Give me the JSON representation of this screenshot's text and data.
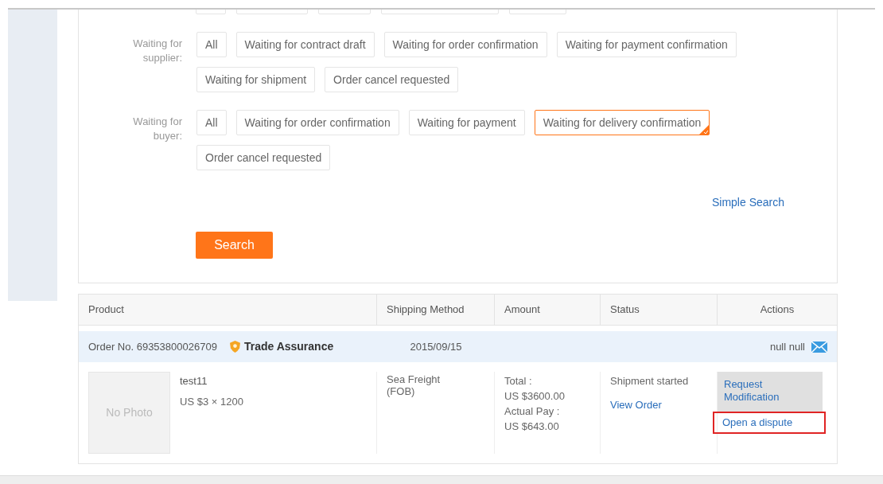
{
  "filter_groups": [
    {
      "label": "Waiting for supplier:",
      "chips": [
        {
          "label": "All",
          "selected": false
        },
        {
          "label": "Waiting for contract draft",
          "selected": false
        },
        {
          "label": "Waiting for order confirmation",
          "selected": false
        },
        {
          "label": "Waiting for payment confirmation",
          "selected": false
        },
        {
          "label": "Waiting for shipment",
          "selected": false
        },
        {
          "label": "Order cancel requested",
          "selected": false
        }
      ]
    },
    {
      "label": "Waiting for buyer:",
      "chips": [
        {
          "label": "All",
          "selected": false
        },
        {
          "label": "Waiting for order confirmation",
          "selected": false
        },
        {
          "label": "Waiting for payment",
          "selected": false
        },
        {
          "label": "Waiting for delivery confirmation",
          "selected": true
        },
        {
          "label": "Order cancel requested",
          "selected": false
        }
      ]
    }
  ],
  "simple_search_link": "Simple Search",
  "search_button": "Search",
  "table": {
    "columns": [
      "Product",
      "Shipping Method",
      "Amount",
      "Status",
      "Actions"
    ],
    "orders": [
      {
        "order_no": "Order No. 69353800026709",
        "badge": "Trade Assurance",
        "date": "2015/09/15",
        "contact": "null null",
        "product": {
          "photo": "No Photo",
          "name": "test11",
          "price": "US $3 × 1200"
        },
        "shipping": "Sea Freight (FOB)",
        "amount": [
          "Total :",
          "US $3600.00",
          "Actual Pay :",
          "US $643.00"
        ],
        "status": "Shipment started",
        "status_link": "View Order",
        "actions": [
          {
            "label": "Request Modification",
            "highlighted": false,
            "hovered": true
          },
          {
            "label": "Open a dispute",
            "highlighted": true,
            "hovered": false
          }
        ]
      }
    ]
  }
}
